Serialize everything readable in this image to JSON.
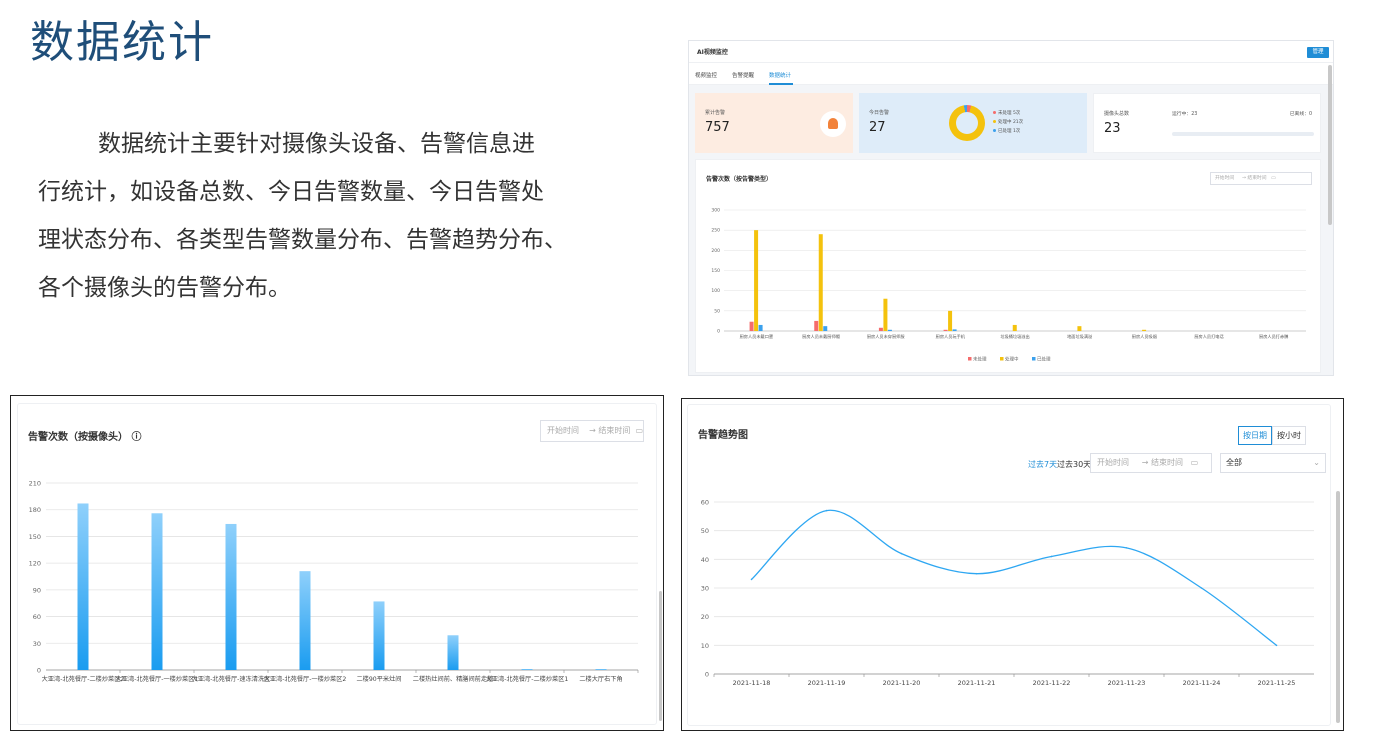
{
  "slide": {
    "title": "数据统计",
    "description_lines": [
      "数据统计主要针对摄像头设备、告警信息进",
      "行统计，如设备总数、今日告警数量、今日告警处",
      "理状态分布、各类型告警数量分布、告警趋势分布、",
      "各个摄像头的告警分布。"
    ]
  },
  "app": {
    "title": "AI视频监控",
    "manage_label": "管理",
    "tabs": [
      "视频监控",
      "告警提醒",
      "数据统计"
    ],
    "active_tab": "数据统计",
    "cards": {
      "total_alarm": {
        "label": "累计告警",
        "value": "757"
      },
      "today_alarm": {
        "label": "今日告警",
        "value": "27",
        "legend": [
          {
            "label": "未处理",
            "count": "5次",
            "color": "#f56c6c"
          },
          {
            "label": "处理中",
            "count": "21次",
            "color": "#f4c20d"
          },
          {
            "label": "已处理",
            "count": "1次",
            "color": "#3ba1ed"
          }
        ]
      },
      "camera": {
        "label": "摄像头总数",
        "value": "23",
        "running": "运行中：23",
        "offline": "已离线：0"
      }
    },
    "date_start_placeholder": "开始时间",
    "date_arrow": "→",
    "date_end_placeholder": "结束时间"
  },
  "chart_type": {
    "title": "告警次数（按告警类型）",
    "legend_colors": {
      "未处理": "#f56c6c",
      "处理中": "#f4c20d",
      "已处理": "#3ba1ed"
    }
  },
  "chart_camera": {
    "title": "告警次数（按摄像头）"
  },
  "chart_trend": {
    "title": "告警趋势图",
    "toggle": [
      "按日期",
      "按小时"
    ],
    "active_toggle": "按日期",
    "quick": [
      "过去7天",
      "过去30天"
    ],
    "active_quick": "过去7天",
    "scope": "全部"
  },
  "chart_data": [
    {
      "type": "bar",
      "title": "告警次数（按告警类型）",
      "categories": [
        "厨房人员未戴口罩",
        "厨房人员未戴厨师帽",
        "厨房人员未穿厨师服",
        "厨房人员玩手机",
        "垃圾桶垃圾溢出",
        "地面垃圾满溢",
        "厨房人员吸烟",
        "厨房人员打电话",
        "厨房人员打赤膊"
      ],
      "series": [
        {
          "name": "未处理",
          "values": [
            23,
            25,
            8,
            3,
            0,
            0,
            0,
            0,
            0
          ]
        },
        {
          "name": "处理中",
          "values": [
            250,
            240,
            80,
            50,
            15,
            12,
            3,
            0,
            0
          ]
        },
        {
          "name": "已处理",
          "values": [
            15,
            12,
            3,
            4,
            0,
            0,
            0,
            0,
            0
          ]
        }
      ],
      "ylim": [
        0,
        300
      ],
      "yticks": [
        0,
        50,
        100,
        150,
        200,
        250,
        300
      ]
    },
    {
      "type": "bar",
      "title": "告警次数（按摄像头）",
      "categories": [
        "大亚湾-北苑餐厅-二楼炒菜区2",
        "大亚湾-北苑餐厅-一楼炒菜区1",
        "大亚湾-北苑餐厅-速冻清洗区",
        "大亚湾-北苑餐厅-一楼炒菜区2",
        "二楼90平米灶间",
        "二楼热灶间前、精膳间前走道",
        "大亚湾-北苑餐厅-二楼炒菜区1",
        "二楼大厅右下角"
      ],
      "values": [
        187,
        176,
        164,
        111,
        77,
        39,
        1,
        1
      ],
      "ylim": [
        0,
        210
      ],
      "yticks": [
        0,
        30,
        60,
        90,
        120,
        150,
        180,
        210
      ]
    },
    {
      "type": "line",
      "title": "告警趋势图",
      "x": [
        "2021-11-18",
        "2021-11-19",
        "2021-11-20",
        "2021-11-21",
        "2021-11-22",
        "2021-11-23",
        "2021-11-24",
        "2021-11-25"
      ],
      "values": [
        33,
        57,
        42,
        35,
        41,
        44,
        30,
        10
      ],
      "ylim": [
        0,
        60
      ],
      "yticks": [
        0,
        10,
        20,
        30,
        40,
        50,
        60
      ]
    }
  ]
}
